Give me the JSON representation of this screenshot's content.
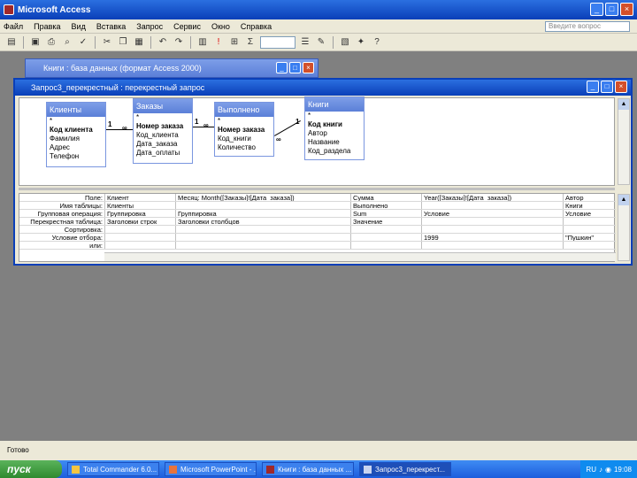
{
  "app": {
    "title": "Microsoft Access",
    "icon": "access-key-icon"
  },
  "menu": {
    "items": [
      "Файл",
      "Правка",
      "Вид",
      "Вставка",
      "Запрос",
      "Сервис",
      "Окно",
      "Справка"
    ],
    "help_placeholder": "Введите вопрос"
  },
  "db_window": {
    "title": "Книги : база данных (формат Access 2000)"
  },
  "query_window": {
    "title": "Запрос3_перекрестный : перекрестный запрос"
  },
  "tables": [
    {
      "name": "Клиенты",
      "fields": [
        "*",
        "Код клиента",
        "Фамилия",
        "Адрес",
        "Телефон"
      ]
    },
    {
      "name": "Заказы",
      "fields": [
        "*",
        "Номер заказа",
        "Код_клиента",
        "Дата_заказа",
        "Дата_оплаты"
      ]
    },
    {
      "name": "Выполнено",
      "fields": [
        "*",
        "Номер заказа",
        "Код_книги",
        "Количество"
      ]
    },
    {
      "name": "Книги",
      "fields": [
        "*",
        "Код книги",
        "Автор",
        "Название",
        "Код_раздела"
      ]
    }
  ],
  "joins": {
    "one_label": "1",
    "many_label": "∞"
  },
  "grid": {
    "row_labels": [
      "Поле:",
      "Имя таблицы:",
      "Групповая операция:",
      "Перекрестная таблица:",
      "Сортировка:",
      "Условие отбора:",
      "или:"
    ],
    "columns": [
      [
        "Клиент",
        "Клиенты",
        "Группировка",
        "Заголовки строк",
        "",
        "",
        ""
      ],
      [
        "Месяц: Month([Заказы]![Дата_заказа])",
        "",
        "Группировка",
        "Заголовки столбцов",
        "",
        "",
        ""
      ],
      [
        "Сумма",
        "Выполнено",
        "Sum",
        "Значение",
        "",
        "",
        ""
      ],
      [
        "Year([Заказы]![Дата_заказа])",
        "",
        "Условие",
        "",
        "",
        "1999",
        ""
      ],
      [
        "Автор",
        "Книги",
        "Условие",
        "",
        "",
        "\"Пушкин\"",
        ""
      ]
    ]
  },
  "status": {
    "text": "Готово"
  },
  "taskbar": {
    "start_label": "пуск",
    "tasks": [
      "Total Commander 6.0...",
      "Microsoft PowerPoint - ...",
      "Книги : база данных ...",
      "Запрос3_перекрест..."
    ],
    "active_index": 3,
    "lang": "RU",
    "clock": "19:08"
  },
  "colors": {
    "titlebar": "#0a3fb8",
    "taskbar": "#1c5ddd",
    "start": "#2f8a2f",
    "mdi_background": "#808080"
  }
}
